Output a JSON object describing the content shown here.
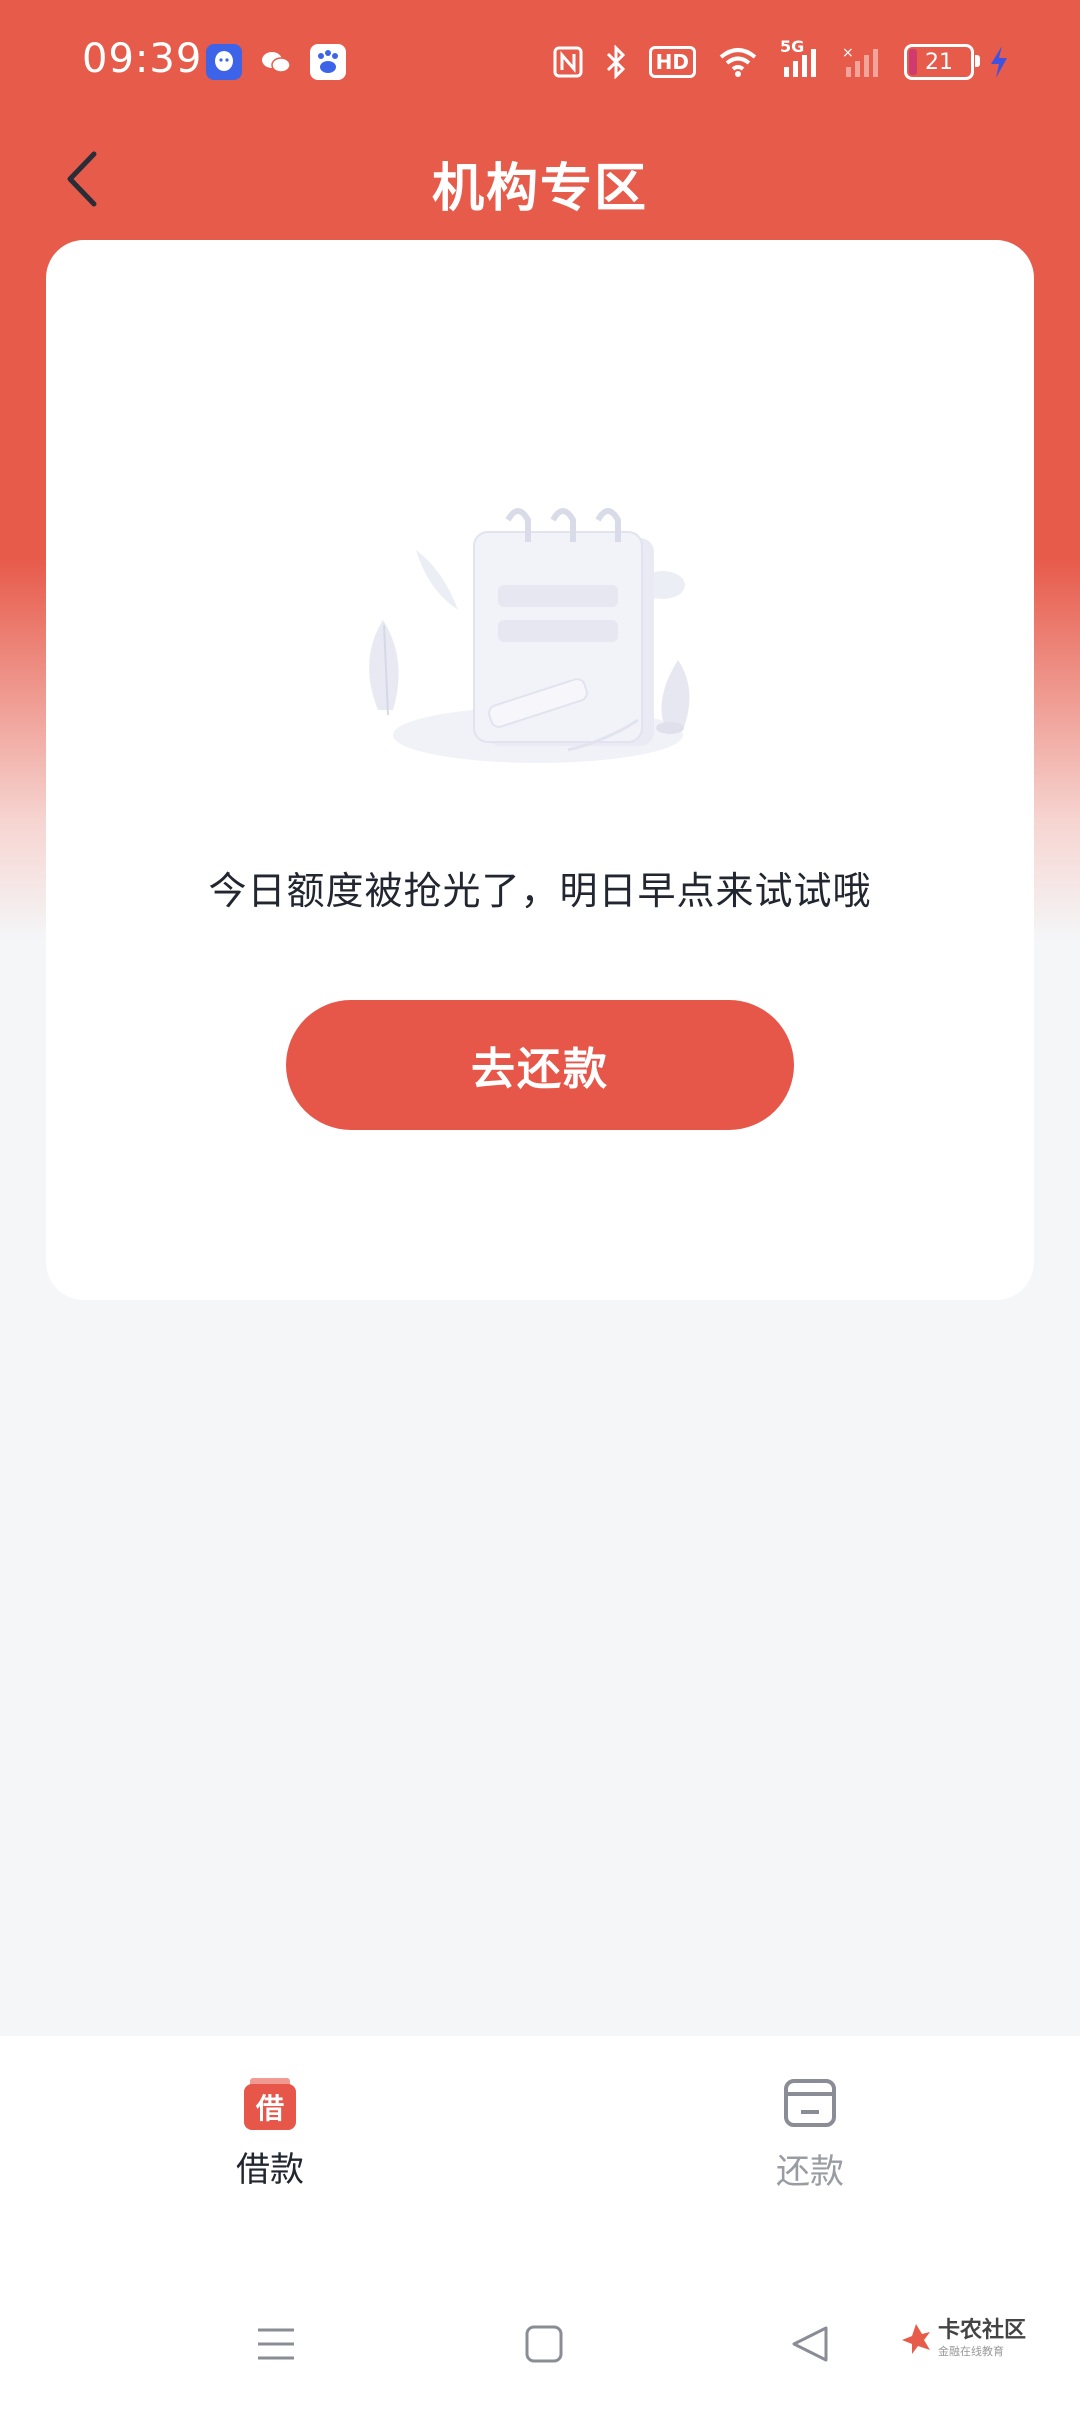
{
  "status_bar": {
    "time": "09:39",
    "battery": "21",
    "network": "5G",
    "hd": "HD"
  },
  "header": {
    "title": "机构专区"
  },
  "empty_state": {
    "message": "今日额度被抢光了，明日早点来试试哦",
    "button_label": "去还款"
  },
  "tabbar": {
    "tabs": [
      {
        "label": "借款",
        "icon_text": "借",
        "active": true
      },
      {
        "label": "还款",
        "active": false
      }
    ]
  },
  "watermark": {
    "title": "卡农社区",
    "subtitle": "金融在线教育"
  },
  "colors": {
    "brand": "#e75b4b",
    "button": "#e6574a",
    "background": "#f5f6f8",
    "text_primary": "#222631",
    "text_inactive": "#9a9ca4"
  }
}
